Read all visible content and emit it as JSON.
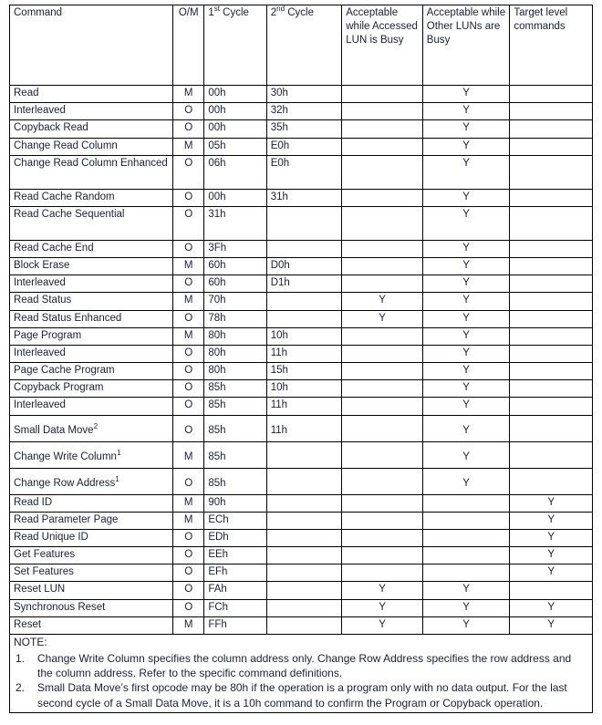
{
  "table": {
    "headers": [
      {
        "key": "command",
        "label": "Command"
      },
      {
        "key": "om",
        "label": "O/M"
      },
      {
        "key": "cycle1",
        "label": "1",
        "sup": "st",
        "suffix": " Cycle"
      },
      {
        "key": "cycle2",
        "label": "2",
        "sup": "nd",
        "suffix": " Cycle"
      },
      {
        "key": "acceptable_accessed_lun_busy",
        "label": "Acceptable while Accessed LUN is Busy"
      },
      {
        "key": "acceptable_other_luns_busy",
        "label": "Acceptable while Other LUNs are Busy"
      },
      {
        "key": "target_level_commands",
        "label": "Target level commands"
      }
    ],
    "rows": [
      {
        "command": "Read",
        "indent": false,
        "sup": "",
        "om": "M",
        "cycle1": "00h",
        "cycle2": "30h",
        "acc": "",
        "oth": "Y",
        "tgt": "",
        "lines": 1
      },
      {
        "command": "Interleaved",
        "indent": true,
        "sup": "",
        "om": "O",
        "cycle1": "00h",
        "cycle2": "32h",
        "acc": "",
        "oth": "Y",
        "tgt": "",
        "lines": 1
      },
      {
        "command": "Copyback Read",
        "indent": false,
        "sup": "",
        "om": "O",
        "cycle1": "00h",
        "cycle2": "35h",
        "acc": "",
        "oth": "Y",
        "tgt": "",
        "lines": 1
      },
      {
        "command": "Change Read Column",
        "indent": false,
        "sup": "",
        "om": "M",
        "cycle1": "05h",
        "cycle2": "E0h",
        "acc": "",
        "oth": "Y",
        "tgt": "",
        "lines": 1
      },
      {
        "command": "Change Read Column Enhanced",
        "indent": false,
        "sup": "",
        "om": "O",
        "cycle1": "06h",
        "cycle2": "E0h",
        "acc": "",
        "oth": "Y",
        "tgt": "",
        "lines": 2
      },
      {
        "command": "Read Cache Random",
        "indent": false,
        "sup": "",
        "om": "O",
        "cycle1": "00h",
        "cycle2": "31h",
        "acc": "",
        "oth": "Y",
        "tgt": "",
        "lines": 1
      },
      {
        "command": "Read Cache Sequential",
        "indent": false,
        "sup": "",
        "om": "O",
        "cycle1": "31h",
        "cycle2": "",
        "acc": "",
        "oth": "Y",
        "tgt": "",
        "lines": 2
      },
      {
        "command": "Read Cache End",
        "indent": false,
        "sup": "",
        "om": "O",
        "cycle1": "3Fh",
        "cycle2": "",
        "acc": "",
        "oth": "Y",
        "tgt": "",
        "lines": 1
      },
      {
        "command": "Block Erase",
        "indent": false,
        "sup": "",
        "om": "M",
        "cycle1": "60h",
        "cycle2": "D0h",
        "acc": "",
        "oth": "Y",
        "tgt": "",
        "lines": 1
      },
      {
        "command": "Interleaved",
        "indent": true,
        "sup": "",
        "om": "O",
        "cycle1": "60h",
        "cycle2": "D1h",
        "acc": "",
        "oth": "Y",
        "tgt": "",
        "lines": 1
      },
      {
        "command": "Read Status",
        "indent": false,
        "sup": "",
        "om": "M",
        "cycle1": "70h",
        "cycle2": "",
        "acc": "Y",
        "oth": "Y",
        "tgt": "",
        "lines": 1
      },
      {
        "command": "Read Status Enhanced",
        "indent": false,
        "sup": "",
        "om": "O",
        "cycle1": "78h",
        "cycle2": "",
        "acc": "Y",
        "oth": "Y",
        "tgt": "",
        "lines": 1
      },
      {
        "command": "Page Program",
        "indent": false,
        "sup": "",
        "om": "M",
        "cycle1": "80h",
        "cycle2": "10h",
        "acc": "",
        "oth": "Y",
        "tgt": "",
        "lines": 1
      },
      {
        "command": "Interleaved",
        "indent": true,
        "sup": "",
        "om": "O",
        "cycle1": "80h",
        "cycle2": "11h",
        "acc": "",
        "oth": "Y",
        "tgt": "",
        "lines": 1
      },
      {
        "command": "Page Cache Program",
        "indent": false,
        "sup": "",
        "om": "O",
        "cycle1": "80h",
        "cycle2": "15h",
        "acc": "",
        "oth": "Y",
        "tgt": "",
        "lines": 1
      },
      {
        "command": "Copyback Program",
        "indent": false,
        "sup": "",
        "om": "O",
        "cycle1": "85h",
        "cycle2": "10h",
        "acc": "",
        "oth": "Y",
        "tgt": "",
        "lines": 1
      },
      {
        "command": "Interleaved",
        "indent": true,
        "sup": "",
        "om": "O",
        "cycle1": "85h",
        "cycle2": "11h",
        "acc": "",
        "oth": "Y",
        "tgt": "",
        "lines": 1
      },
      {
        "command": "Small Data Move",
        "indent": false,
        "sup": "2",
        "om": "O",
        "cycle1": "85h",
        "cycle2": "11h",
        "acc": "",
        "oth": "Y",
        "tgt": "",
        "lines": 1
      },
      {
        "command": "Change Write Column",
        "indent": false,
        "sup": "1",
        "om": "M",
        "cycle1": "85h",
        "cycle2": "",
        "acc": "",
        "oth": "Y",
        "tgt": "",
        "lines": 1
      },
      {
        "command": "Change Row Address",
        "indent": false,
        "sup": "1",
        "om": "O",
        "cycle1": "85h",
        "cycle2": "",
        "acc": "",
        "oth": "Y",
        "tgt": "",
        "lines": 1
      },
      {
        "command": "Read ID",
        "indent": false,
        "sup": "",
        "om": "M",
        "cycle1": "90h",
        "cycle2": "",
        "acc": "",
        "oth": "",
        "tgt": "Y",
        "lines": 1
      },
      {
        "command": "Read Parameter Page",
        "indent": false,
        "sup": "",
        "om": "M",
        "cycle1": "ECh",
        "cycle2": "",
        "acc": "",
        "oth": "",
        "tgt": "Y",
        "lines": 1
      },
      {
        "command": "Read Unique ID",
        "indent": false,
        "sup": "",
        "om": "O",
        "cycle1": "EDh",
        "cycle2": "",
        "acc": "",
        "oth": "",
        "tgt": "Y",
        "lines": 1
      },
      {
        "command": "Get Features",
        "indent": false,
        "sup": "",
        "om": "O",
        "cycle1": "EEh",
        "cycle2": "",
        "acc": "",
        "oth": "",
        "tgt": "Y",
        "lines": 1
      },
      {
        "command": "Set Features",
        "indent": false,
        "sup": "",
        "om": "O",
        "cycle1": "EFh",
        "cycle2": "",
        "acc": "",
        "oth": "",
        "tgt": "Y",
        "lines": 1
      },
      {
        "command": "Reset LUN",
        "indent": false,
        "sup": "",
        "om": "O",
        "cycle1": "FAh",
        "cycle2": "",
        "acc": "Y",
        "oth": "Y",
        "tgt": "",
        "lines": 1
      },
      {
        "command": "Synchronous Reset",
        "indent": false,
        "sup": "",
        "om": "O",
        "cycle1": "FCh",
        "cycle2": "",
        "acc": "Y",
        "oth": "Y",
        "tgt": "Y",
        "lines": 1
      },
      {
        "command": "Reset",
        "indent": false,
        "sup": "",
        "om": "M",
        "cycle1": "FFh",
        "cycle2": "",
        "acc": "Y",
        "oth": "Y",
        "tgt": "Y",
        "lines": 1
      }
    ]
  },
  "note": {
    "title": "NOTE:",
    "items": [
      {
        "num": "1.",
        "text": "Change Write Column specifies the column address only.  Change Row Address specifies the row address and the column address.  Refer to the specific command definitions."
      },
      {
        "num": "2.",
        "text": "Small Data Move’s first opcode may be 80h if the operation is a program only with no data output.  For the last second cycle of a Small Data Move, it is a 10h command to confirm the Program or Copyback operation."
      }
    ]
  }
}
